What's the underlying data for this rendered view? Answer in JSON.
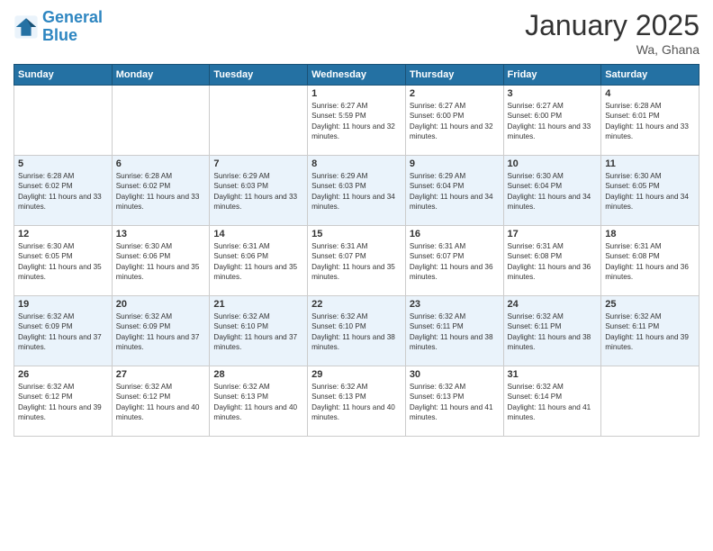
{
  "header": {
    "logo_line1": "General",
    "logo_line2": "Blue",
    "month_year": "January 2025",
    "location": "Wa, Ghana"
  },
  "days_of_week": [
    "Sunday",
    "Monday",
    "Tuesday",
    "Wednesday",
    "Thursday",
    "Friday",
    "Saturday"
  ],
  "weeks": [
    {
      "alt": false,
      "days": [
        {
          "num": "",
          "info": ""
        },
        {
          "num": "",
          "info": ""
        },
        {
          "num": "",
          "info": ""
        },
        {
          "num": "1",
          "info": "Sunrise: 6:27 AM\nSunset: 5:59 PM\nDaylight: 11 hours and 32 minutes."
        },
        {
          "num": "2",
          "info": "Sunrise: 6:27 AM\nSunset: 6:00 PM\nDaylight: 11 hours and 32 minutes."
        },
        {
          "num": "3",
          "info": "Sunrise: 6:27 AM\nSunset: 6:00 PM\nDaylight: 11 hours and 33 minutes."
        },
        {
          "num": "4",
          "info": "Sunrise: 6:28 AM\nSunset: 6:01 PM\nDaylight: 11 hours and 33 minutes."
        }
      ]
    },
    {
      "alt": true,
      "days": [
        {
          "num": "5",
          "info": "Sunrise: 6:28 AM\nSunset: 6:02 PM\nDaylight: 11 hours and 33 minutes."
        },
        {
          "num": "6",
          "info": "Sunrise: 6:28 AM\nSunset: 6:02 PM\nDaylight: 11 hours and 33 minutes."
        },
        {
          "num": "7",
          "info": "Sunrise: 6:29 AM\nSunset: 6:03 PM\nDaylight: 11 hours and 33 minutes."
        },
        {
          "num": "8",
          "info": "Sunrise: 6:29 AM\nSunset: 6:03 PM\nDaylight: 11 hours and 34 minutes."
        },
        {
          "num": "9",
          "info": "Sunrise: 6:29 AM\nSunset: 6:04 PM\nDaylight: 11 hours and 34 minutes."
        },
        {
          "num": "10",
          "info": "Sunrise: 6:30 AM\nSunset: 6:04 PM\nDaylight: 11 hours and 34 minutes."
        },
        {
          "num": "11",
          "info": "Sunrise: 6:30 AM\nSunset: 6:05 PM\nDaylight: 11 hours and 34 minutes."
        }
      ]
    },
    {
      "alt": false,
      "days": [
        {
          "num": "12",
          "info": "Sunrise: 6:30 AM\nSunset: 6:05 PM\nDaylight: 11 hours and 35 minutes."
        },
        {
          "num": "13",
          "info": "Sunrise: 6:30 AM\nSunset: 6:06 PM\nDaylight: 11 hours and 35 minutes."
        },
        {
          "num": "14",
          "info": "Sunrise: 6:31 AM\nSunset: 6:06 PM\nDaylight: 11 hours and 35 minutes."
        },
        {
          "num": "15",
          "info": "Sunrise: 6:31 AM\nSunset: 6:07 PM\nDaylight: 11 hours and 35 minutes."
        },
        {
          "num": "16",
          "info": "Sunrise: 6:31 AM\nSunset: 6:07 PM\nDaylight: 11 hours and 36 minutes."
        },
        {
          "num": "17",
          "info": "Sunrise: 6:31 AM\nSunset: 6:08 PM\nDaylight: 11 hours and 36 minutes."
        },
        {
          "num": "18",
          "info": "Sunrise: 6:31 AM\nSunset: 6:08 PM\nDaylight: 11 hours and 36 minutes."
        }
      ]
    },
    {
      "alt": true,
      "days": [
        {
          "num": "19",
          "info": "Sunrise: 6:32 AM\nSunset: 6:09 PM\nDaylight: 11 hours and 37 minutes."
        },
        {
          "num": "20",
          "info": "Sunrise: 6:32 AM\nSunset: 6:09 PM\nDaylight: 11 hours and 37 minutes."
        },
        {
          "num": "21",
          "info": "Sunrise: 6:32 AM\nSunset: 6:10 PM\nDaylight: 11 hours and 37 minutes."
        },
        {
          "num": "22",
          "info": "Sunrise: 6:32 AM\nSunset: 6:10 PM\nDaylight: 11 hours and 38 minutes."
        },
        {
          "num": "23",
          "info": "Sunrise: 6:32 AM\nSunset: 6:11 PM\nDaylight: 11 hours and 38 minutes."
        },
        {
          "num": "24",
          "info": "Sunrise: 6:32 AM\nSunset: 6:11 PM\nDaylight: 11 hours and 38 minutes."
        },
        {
          "num": "25",
          "info": "Sunrise: 6:32 AM\nSunset: 6:11 PM\nDaylight: 11 hours and 39 minutes."
        }
      ]
    },
    {
      "alt": false,
      "days": [
        {
          "num": "26",
          "info": "Sunrise: 6:32 AM\nSunset: 6:12 PM\nDaylight: 11 hours and 39 minutes."
        },
        {
          "num": "27",
          "info": "Sunrise: 6:32 AM\nSunset: 6:12 PM\nDaylight: 11 hours and 40 minutes."
        },
        {
          "num": "28",
          "info": "Sunrise: 6:32 AM\nSunset: 6:13 PM\nDaylight: 11 hours and 40 minutes."
        },
        {
          "num": "29",
          "info": "Sunrise: 6:32 AM\nSunset: 6:13 PM\nDaylight: 11 hours and 40 minutes."
        },
        {
          "num": "30",
          "info": "Sunrise: 6:32 AM\nSunset: 6:13 PM\nDaylight: 11 hours and 41 minutes."
        },
        {
          "num": "31",
          "info": "Sunrise: 6:32 AM\nSunset: 6:14 PM\nDaylight: 11 hours and 41 minutes."
        },
        {
          "num": "",
          "info": ""
        }
      ]
    }
  ]
}
